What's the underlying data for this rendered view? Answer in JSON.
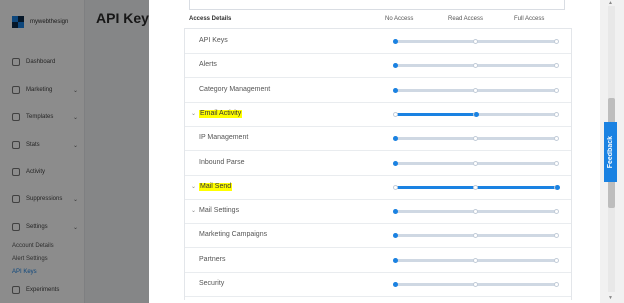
{
  "background": {
    "brand": "mywebthesign",
    "page_title": "API Keys",
    "nav": [
      {
        "label": "Dashboard",
        "icon": "dashboard-icon",
        "chevron": false
      },
      {
        "label": "Marketing",
        "icon": "megaphone-icon",
        "chevron": true
      },
      {
        "label": "Templates",
        "icon": "template-icon",
        "chevron": true
      },
      {
        "label": "Stats",
        "icon": "chart-icon",
        "chevron": true
      },
      {
        "label": "Activity",
        "icon": "activity-icon",
        "chevron": false
      },
      {
        "label": "Suppressions",
        "icon": "block-icon",
        "chevron": true
      },
      {
        "label": "Settings",
        "icon": "gear-icon",
        "chevron": true
      }
    ],
    "sub_links": [
      "Account Details",
      "Alert Settings",
      "API Keys"
    ],
    "experiments": "Experiments"
  },
  "drawer": {
    "headers": {
      "access": "Access Details",
      "none": "No Access",
      "read": "Read Access",
      "full": "Full Access"
    },
    "rows": [
      {
        "label": "API Keys",
        "chevron": false,
        "highlight": false,
        "level": "none"
      },
      {
        "label": "Alerts",
        "chevron": false,
        "highlight": false,
        "level": "none"
      },
      {
        "label": "Category Management",
        "chevron": false,
        "highlight": false,
        "level": "none"
      },
      {
        "label": "Email Activity",
        "chevron": true,
        "highlight": true,
        "level": "read"
      },
      {
        "label": "IP Management",
        "chevron": false,
        "highlight": false,
        "level": "none"
      },
      {
        "label": "Inbound Parse",
        "chevron": false,
        "highlight": false,
        "level": "none"
      },
      {
        "label": "Mail Send",
        "chevron": true,
        "highlight": true,
        "level": "full"
      },
      {
        "label": "Mail Settings",
        "chevron": true,
        "highlight": false,
        "level": "none"
      },
      {
        "label": "Marketing Campaigns",
        "chevron": false,
        "highlight": false,
        "level": "none"
      },
      {
        "label": "Partners",
        "chevron": false,
        "highlight": false,
        "level": "none"
      },
      {
        "label": "Security",
        "chevron": false,
        "highlight": false,
        "level": "none"
      }
    ]
  },
  "feedback": {
    "label": "Feedback"
  },
  "colors": {
    "accent": "#1A82E2",
    "highlight": "#ffff00"
  }
}
